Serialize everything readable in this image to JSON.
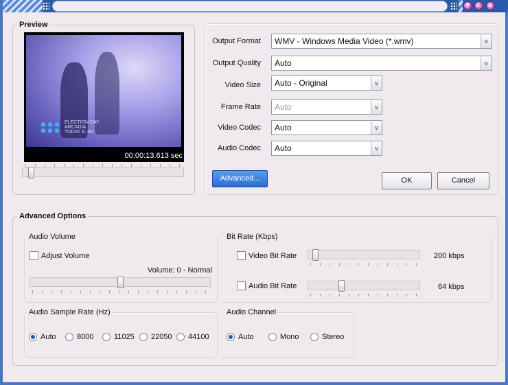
{
  "preview": {
    "legend": "Preview",
    "timecode": "00:00:13.613 sec",
    "caption": [
      "ELECTION DAY",
      "ARCADIA",
      "TODAY 8, 8M"
    ]
  },
  "format": {
    "output_format_label": "Output Format",
    "output_format_value": "WMV - Windows Media Video (*.wmv)",
    "output_quality_label": "Output Quality",
    "output_quality_value": "Auto",
    "video_size_label": "Video Size",
    "video_size_value": "Auto - Original",
    "frame_rate_label": "Frame Rate",
    "frame_rate_value": "Auto",
    "video_codec_label": "Video Codec",
    "video_codec_value": "Auto",
    "audio_codec_label": "Audio Codec",
    "audio_codec_value": "Auto",
    "advanced_label": "Advanced...",
    "ok_label": "OK",
    "cancel_label": "Cancel"
  },
  "advanced": {
    "legend": "Advanced Options",
    "audio_volume": {
      "label": "Audio Volume",
      "adjust_label": "Adjust Volume",
      "volume_text": "Volume: 0 - Normal",
      "level": 0.5
    },
    "bit_rate": {
      "label": "Bit Rate (Kbps)",
      "video_label": "Video Bit Rate",
      "video_value": "200 kbps",
      "audio_label": "Audio Bit Rate",
      "audio_value": "64 kbps"
    },
    "sample_rate": {
      "label": "Audio Sample Rate (Hz)",
      "options": [
        "Auto",
        "8000",
        "11025",
        "22050",
        "44100"
      ],
      "selected": "Auto"
    },
    "channel": {
      "label": "Audio Channel",
      "options": [
        "Auto",
        "Mono",
        "Stereo"
      ],
      "selected": "Auto"
    }
  },
  "colors": {
    "accent": "#2a6ed0",
    "window_frame": "#4a78c0"
  }
}
